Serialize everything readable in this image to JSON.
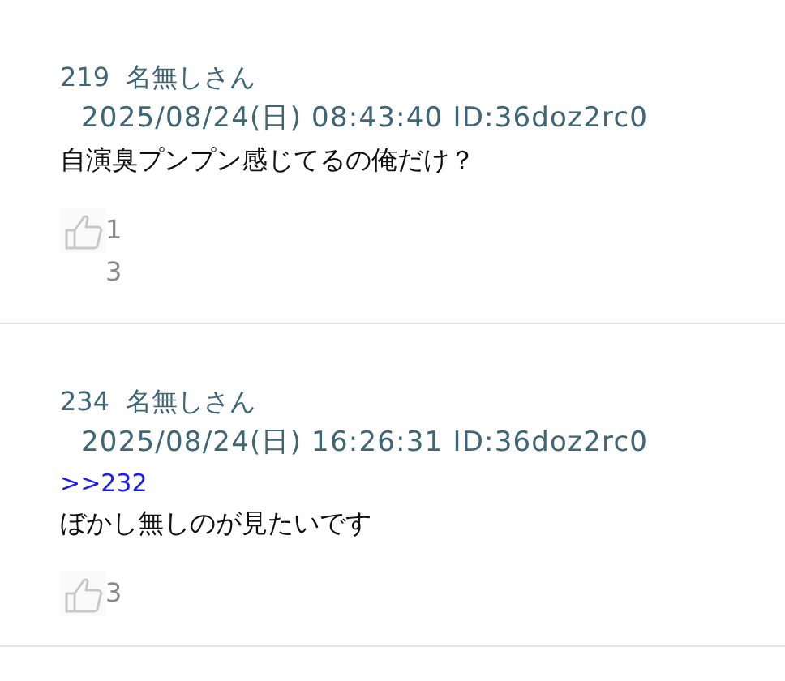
{
  "posts": [
    {
      "number": "219",
      "name": "名無しさん",
      "date": "2025/08/24(日) 08:43:40 ID:36doz2rc0",
      "body": "自演臭プンプン感じてるの俺だけ？",
      "likes": "13"
    },
    {
      "number": "234",
      "name": "名無しさん",
      "date": "2025/08/24(日) 16:26:31 ID:36doz2rc0",
      "anchor": ">>232",
      "body": "ぼかし無しのが見たいです",
      "likes": "3"
    }
  ]
}
